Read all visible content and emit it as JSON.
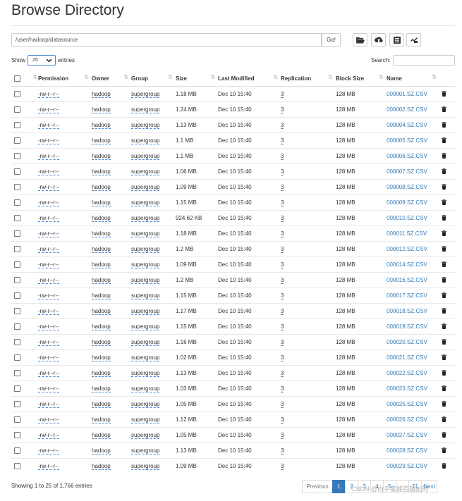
{
  "page": {
    "title": "Browse Directory"
  },
  "path_bar": {
    "value": "/user/hadoop/datasource",
    "go_label": "Go!"
  },
  "toolbar": {
    "buttons": [
      {
        "icon": "folder-open-icon"
      },
      {
        "icon": "upload-icon"
      },
      {
        "icon": "list-icon"
      },
      {
        "icon": "clipboard-icon"
      }
    ]
  },
  "length_control": {
    "show_label": "Show",
    "selected": "25",
    "entries_label": "entries"
  },
  "search": {
    "label": "Search:",
    "value": ""
  },
  "table": {
    "columns": [
      "Permission",
      "Owner",
      "Group",
      "Size",
      "Last Modified",
      "Replication",
      "Block Size",
      "Name"
    ],
    "rows": [
      {
        "permission": "-rw-r--r--",
        "owner": "hadoop",
        "group": "supergroup",
        "size": "1.18 MB",
        "modified": "Dec 10 15:40",
        "replication": "3",
        "block_size": "128 MB",
        "name": "000001.SZ.CSV"
      },
      {
        "permission": "-rw-r--r--",
        "owner": "hadoop",
        "group": "supergroup",
        "size": "1.24 MB",
        "modified": "Dec 10 15:40",
        "replication": "3",
        "block_size": "128 MB",
        "name": "000002.SZ.CSV"
      },
      {
        "permission": "-rw-r--r--",
        "owner": "hadoop",
        "group": "supergroup",
        "size": "1.13 MB",
        "modified": "Dec 10 15:40",
        "replication": "3",
        "block_size": "128 MB",
        "name": "000004.SZ.CSV"
      },
      {
        "permission": "-rw-r--r--",
        "owner": "hadoop",
        "group": "supergroup",
        "size": "1.1 MB",
        "modified": "Dec 10 15:40",
        "replication": "3",
        "block_size": "128 MB",
        "name": "000005.SZ.CSV"
      },
      {
        "permission": "-rw-r--r--",
        "owner": "hadoop",
        "group": "supergroup",
        "size": "1.1 MB",
        "modified": "Dec 10 15:40",
        "replication": "3",
        "block_size": "128 MB",
        "name": "000006.SZ.CSV"
      },
      {
        "permission": "-rw-r--r--",
        "owner": "hadoop",
        "group": "supergroup",
        "size": "1.06 MB",
        "modified": "Dec 10 15:40",
        "replication": "3",
        "block_size": "128 MB",
        "name": "000007.SZ.CSV"
      },
      {
        "permission": "-rw-r--r--",
        "owner": "hadoop",
        "group": "supergroup",
        "size": "1.09 MB",
        "modified": "Dec 10 15:40",
        "replication": "3",
        "block_size": "128 MB",
        "name": "000008.SZ.CSV"
      },
      {
        "permission": "-rw-r--r--",
        "owner": "hadoop",
        "group": "supergroup",
        "size": "1.15 MB",
        "modified": "Dec 10 15:40",
        "replication": "3",
        "block_size": "128 MB",
        "name": "000009.SZ.CSV"
      },
      {
        "permission": "-rw-r--r--",
        "owner": "hadoop",
        "group": "supergroup",
        "size": "924.62 KB",
        "modified": "Dec 10 15:40",
        "replication": "3",
        "block_size": "128 MB",
        "name": "000010.SZ.CSV"
      },
      {
        "permission": "-rw-r--r--",
        "owner": "hadoop",
        "group": "supergroup",
        "size": "1.18 MB",
        "modified": "Dec 10 15:40",
        "replication": "3",
        "block_size": "128 MB",
        "name": "000011.SZ.CSV"
      },
      {
        "permission": "-rw-r--r--",
        "owner": "hadoop",
        "group": "supergroup",
        "size": "1.2 MB",
        "modified": "Dec 10 15:40",
        "replication": "3",
        "block_size": "128 MB",
        "name": "000012.SZ.CSV"
      },
      {
        "permission": "-rw-r--r--",
        "owner": "hadoop",
        "group": "supergroup",
        "size": "1.09 MB",
        "modified": "Dec 10 15:40",
        "replication": "3",
        "block_size": "128 MB",
        "name": "000014.SZ.CSV"
      },
      {
        "permission": "-rw-r--r--",
        "owner": "hadoop",
        "group": "supergroup",
        "size": "1.2 MB",
        "modified": "Dec 10 15:40",
        "replication": "3",
        "block_size": "128 MB",
        "name": "000016.SZ.CSV"
      },
      {
        "permission": "-rw-r--r--",
        "owner": "hadoop",
        "group": "supergroup",
        "size": "1.15 MB",
        "modified": "Dec 10 15:40",
        "replication": "3",
        "block_size": "128 MB",
        "name": "000017.SZ.CSV"
      },
      {
        "permission": "-rw-r--r--",
        "owner": "hadoop",
        "group": "supergroup",
        "size": "1.17 MB",
        "modified": "Dec 10 15:40",
        "replication": "3",
        "block_size": "128 MB",
        "name": "000018.SZ.CSV"
      },
      {
        "permission": "-rw-r--r--",
        "owner": "hadoop",
        "group": "supergroup",
        "size": "1.15 MB",
        "modified": "Dec 10 15:40",
        "replication": "3",
        "block_size": "128 MB",
        "name": "000019.SZ.CSV"
      },
      {
        "permission": "-rw-r--r--",
        "owner": "hadoop",
        "group": "supergroup",
        "size": "1.16 MB",
        "modified": "Dec 10 15:40",
        "replication": "3",
        "block_size": "128 MB",
        "name": "000020.SZ.CSV"
      },
      {
        "permission": "-rw-r--r--",
        "owner": "hadoop",
        "group": "supergroup",
        "size": "1.02 MB",
        "modified": "Dec 10 15:40",
        "replication": "3",
        "block_size": "128 MB",
        "name": "000021.SZ.CSV"
      },
      {
        "permission": "-rw-r--r--",
        "owner": "hadoop",
        "group": "supergroup",
        "size": "1.13 MB",
        "modified": "Dec 10 15:40",
        "replication": "3",
        "block_size": "128 MB",
        "name": "000022.SZ.CSV"
      },
      {
        "permission": "-rw-r--r--",
        "owner": "hadoop",
        "group": "supergroup",
        "size": "1.03 MB",
        "modified": "Dec 10 15:40",
        "replication": "3",
        "block_size": "128 MB",
        "name": "000023.SZ.CSV"
      },
      {
        "permission": "-rw-r--r--",
        "owner": "hadoop",
        "group": "supergroup",
        "size": "1.05 MB",
        "modified": "Dec 10 15:40",
        "replication": "3",
        "block_size": "128 MB",
        "name": "000025.SZ.CSV"
      },
      {
        "permission": "-rw-r--r--",
        "owner": "hadoop",
        "group": "supergroup",
        "size": "1.12 MB",
        "modified": "Dec 10 15:40",
        "replication": "3",
        "block_size": "128 MB",
        "name": "000026.SZ.CSV"
      },
      {
        "permission": "-rw-r--r--",
        "owner": "hadoop",
        "group": "supergroup",
        "size": "1.05 MB",
        "modified": "Dec 10 15:40",
        "replication": "3",
        "block_size": "128 MB",
        "name": "000027.SZ.CSV"
      },
      {
        "permission": "-rw-r--r--",
        "owner": "hadoop",
        "group": "supergroup",
        "size": "1.13 MB",
        "modified": "Dec 10 15:40",
        "replication": "3",
        "block_size": "128 MB",
        "name": "000028.SZ.CSV"
      },
      {
        "permission": "-rw-r--r--",
        "owner": "hadoop",
        "group": "supergroup",
        "size": "1.09 MB",
        "modified": "Dec 10 15:40",
        "replication": "3",
        "block_size": "128 MB",
        "name": "000029.SZ.CSV"
      }
    ]
  },
  "footer": {
    "info": "Showing 1 to 25 of 1,766 entries",
    "pagination": [
      "Previous",
      "1",
      "2",
      "3",
      "4",
      "5",
      "…",
      "71",
      "Next"
    ],
    "active_page": "1"
  },
  "watermark": "CSDN @白手套能否越扯的",
  "colors": {
    "link": "#337ab7",
    "active_page_bg": "#337ab7",
    "select_border": "#4a88d8"
  }
}
